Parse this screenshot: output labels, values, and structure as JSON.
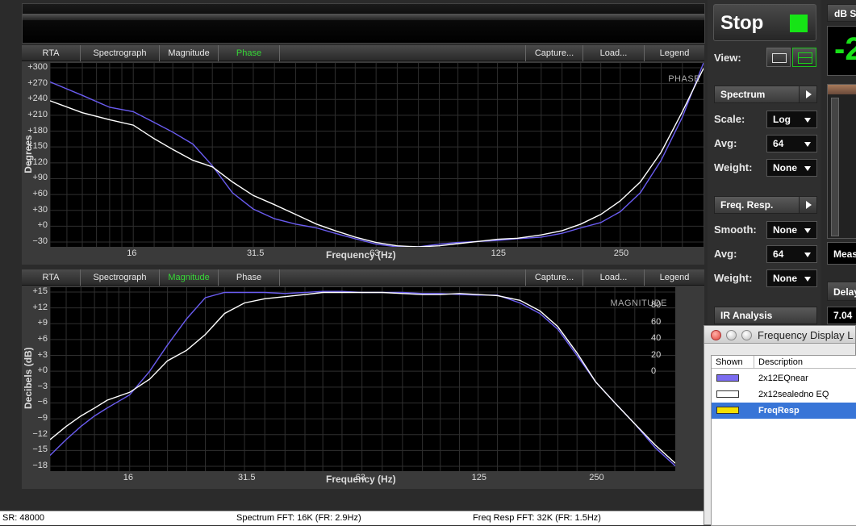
{
  "top_panel": {
    "tabs": [
      {
        "label": "RTA",
        "active": false
      },
      {
        "label": "Spectrograph",
        "active": false
      },
      {
        "label": "Magnitude",
        "active": false
      },
      {
        "label": "Phase",
        "active": true
      }
    ],
    "right_tabs": [
      "Capture...",
      "Load...",
      "Legend"
    ],
    "ylabel": "Degrees",
    "xlabel": "Frequency (Hz)",
    "corner": "PHASE",
    "yticks": [
      "+300",
      "+270",
      "+240",
      "+210",
      "+180",
      "+150",
      "+120",
      "+90",
      "+60",
      "+30",
      "+0",
      "−30"
    ],
    "xticks": [
      "16",
      "31.5",
      "63",
      "125",
      "250"
    ]
  },
  "bottom_panel": {
    "tabs": [
      {
        "label": "RTA",
        "active": false
      },
      {
        "label": "Spectrograph",
        "active": false
      },
      {
        "label": "Magnitude",
        "active": true
      },
      {
        "label": "Phase",
        "active": false
      }
    ],
    "right_tabs": [
      "Capture...",
      "Load...",
      "Legend"
    ],
    "ylabel": "Decibels (dB)",
    "xlabel": "Frequency (Hz)",
    "corner": "MAGNITUDE",
    "yticks": [
      "+15",
      "+12",
      "+9",
      "+6",
      "+3",
      "+0",
      "−3",
      "−6",
      "−9",
      "−12",
      "−15",
      "−18"
    ],
    "yticks_right": [
      "80",
      "60",
      "40",
      "20",
      "0"
    ],
    "xticks": [
      "16",
      "31.5",
      "63",
      "125",
      "250"
    ]
  },
  "sidebar": {
    "stop_label": "Stop",
    "view_label": "View:",
    "spectrum_label": "Spectrum",
    "scale_label": "Scale:",
    "scale_value": "Log",
    "avg_label": "Avg:",
    "avg_value": "64",
    "weight_label": "Weight:",
    "weight_value": "None",
    "freqresp_label": "Freq. Resp.",
    "smooth_label": "Smooth:",
    "smooth_value": "None",
    "avg2_label": "Avg:",
    "avg2_value": "64",
    "weight2_label": "Weight:",
    "weight2_value": "None",
    "ir_label": "IR Analysis"
  },
  "right_strip": {
    "dbs_label": "dB S",
    "level_value": "-2",
    "meas_label": "Meas",
    "delay_label": "Delay",
    "delay_value": "7.04"
  },
  "status": {
    "sr": "SR: 48000",
    "spectrum_fft": "Spectrum FFT: 16K (FR: 2.9Hz)",
    "freqresp_fft": "Freq Resp FFT: 32K (FR: 1.5Hz)"
  },
  "display_window": {
    "title": "Frequency Display L",
    "col_shown": "Shown",
    "col_description": "Description",
    "rows": [
      {
        "name": "2x12EQnear",
        "color": "#7b6cf0",
        "selected": false
      },
      {
        "name": "2x12sealedno EQ",
        "color": "#ffffff",
        "selected": false
      },
      {
        "name": "FreqResp",
        "color": "#f5e000",
        "selected": true
      }
    ]
  },
  "chart_data": [
    {
      "type": "line",
      "title": "PHASE",
      "xlabel": "Frequency (Hz)",
      "ylabel": "Degrees",
      "x_scale": "log",
      "xlim": [
        10,
        400
      ],
      "ylim": [
        -30,
        310
      ],
      "x": [
        10,
        12,
        14,
        16,
        18,
        20,
        22.4,
        25,
        28,
        31.5,
        35.5,
        40,
        45,
        50,
        56,
        63,
        71,
        80,
        90,
        100,
        112,
        125,
        140,
        160,
        180,
        200,
        224,
        250,
        280,
        315,
        355,
        400
      ],
      "series": [
        {
          "name": "2x12EQnear",
          "color": "#6a5cf0",
          "values": [
            275,
            250,
            228,
            220,
            200,
            182,
            160,
            120,
            70,
            40,
            22,
            12,
            5,
            -5,
            -15,
            -25,
            -30,
            -30,
            -25,
            -22,
            -20,
            -18,
            -15,
            -12,
            -5,
            5,
            15,
            35,
            70,
            130,
            210,
            310
          ]
        },
        {
          "name": "2x12sealedno EQ",
          "color": "#ffffff",
          "values": [
            240,
            218,
            205,
            195,
            170,
            150,
            130,
            118,
            90,
            65,
            48,
            30,
            12,
            0,
            -12,
            -22,
            -28,
            -30,
            -28,
            -24,
            -20,
            -16,
            -14,
            -8,
            0,
            12,
            30,
            55,
            90,
            145,
            220,
            300
          ]
        }
      ]
    },
    {
      "type": "line",
      "title": "MAGNITUDE",
      "xlabel": "Frequency (Hz)",
      "ylabel": "Decibels (dB)",
      "x_scale": "log",
      "xlim": [
        10,
        400
      ],
      "ylim": [
        -18,
        17
      ],
      "x": [
        10,
        11,
        12,
        13,
        14,
        16,
        18,
        20,
        22.4,
        25,
        28,
        31.5,
        35.5,
        40,
        45,
        50,
        56,
        63,
        71,
        80,
        90,
        100,
        112,
        125,
        140,
        160,
        180,
        200,
        224,
        250,
        280,
        315,
        355,
        400
      ],
      "series": [
        {
          "name": "2x12EQnear",
          "color": "#6a5cf0",
          "values": [
            -15,
            -12,
            -9.5,
            -7.5,
            -6,
            -3.5,
            1,
            6,
            11,
            15,
            16,
            16,
            16,
            15.8,
            16,
            16.2,
            16.2,
            16,
            16,
            16,
            15.8,
            15.8,
            15.6,
            15.5,
            15.5,
            14,
            12,
            9,
            4,
            -1,
            -5,
            -9,
            -13.5,
            -17
          ]
        },
        {
          "name": "2x12sealedno EQ",
          "color": "#ffffff",
          "values": [
            -12,
            -9.5,
            -7.5,
            -6,
            -4.5,
            -3,
            -0.5,
            3,
            5,
            8,
            12,
            14,
            14.8,
            15.2,
            15.6,
            16,
            16,
            16,
            16,
            15.8,
            15.6,
            15.6,
            15.8,
            15.6,
            15.4,
            14.5,
            12.5,
            9.5,
            4.5,
            -1,
            -5,
            -9,
            -13,
            -16.5
          ]
        }
      ]
    }
  ]
}
